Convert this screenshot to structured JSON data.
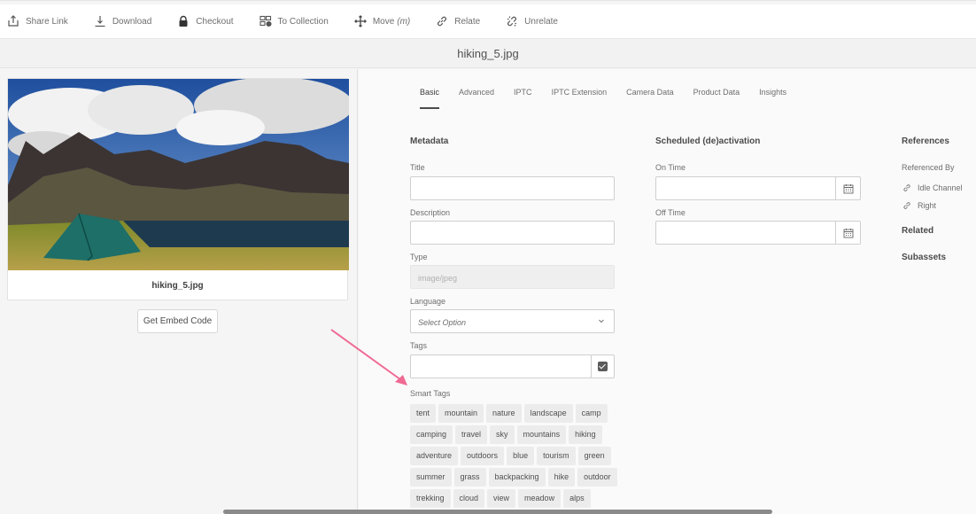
{
  "toolbar": {
    "share": "Share Link",
    "download": "Download",
    "checkout": "Checkout",
    "to_collection": "To Collection",
    "move": "Move",
    "move_hint": "(m)",
    "relate": "Relate",
    "unrelate": "Unrelate"
  },
  "asset": {
    "title": "hiking_5.jpg",
    "caption": "hiking_5.jpg",
    "embed_button": "Get Embed Code"
  },
  "tabs": [
    "Basic",
    "Advanced",
    "IPTC",
    "IPTC Extension",
    "Camera Data",
    "Product Data",
    "Insights"
  ],
  "metadata": {
    "heading": "Metadata",
    "title_label": "Title",
    "title_value": "",
    "description_label": "Description",
    "description_value": "",
    "type_label": "Type",
    "type_value": "image/jpeg",
    "language_label": "Language",
    "language_value": "Select Option",
    "tags_label": "Tags",
    "smart_tags_label": "Smart Tags",
    "smart_tags": [
      [
        "tent",
        "mountain",
        "nature",
        "landscape",
        "camp"
      ],
      [
        "camping",
        "travel",
        "sky",
        "mountains",
        "hiking"
      ],
      [
        "adventure",
        "outdoors",
        "blue",
        "tourism",
        "green"
      ],
      [
        "summer",
        "grass",
        "backpacking",
        "hike",
        "outdoor"
      ],
      [
        "trekking",
        "cloud",
        "view",
        "meadow",
        "alps"
      ]
    ]
  },
  "schedule": {
    "heading": "Scheduled (de)activation",
    "on_label": "On Time",
    "off_label": "Off Time"
  },
  "references": {
    "heading": "References",
    "referenced_by_label": "Referenced By",
    "items": [
      "Idle Channel",
      "Right"
    ],
    "related": "Related",
    "subassets": "Subassets"
  },
  "colors": {
    "accent_arrow": "#f06a94",
    "text": "#4b4b4b"
  }
}
